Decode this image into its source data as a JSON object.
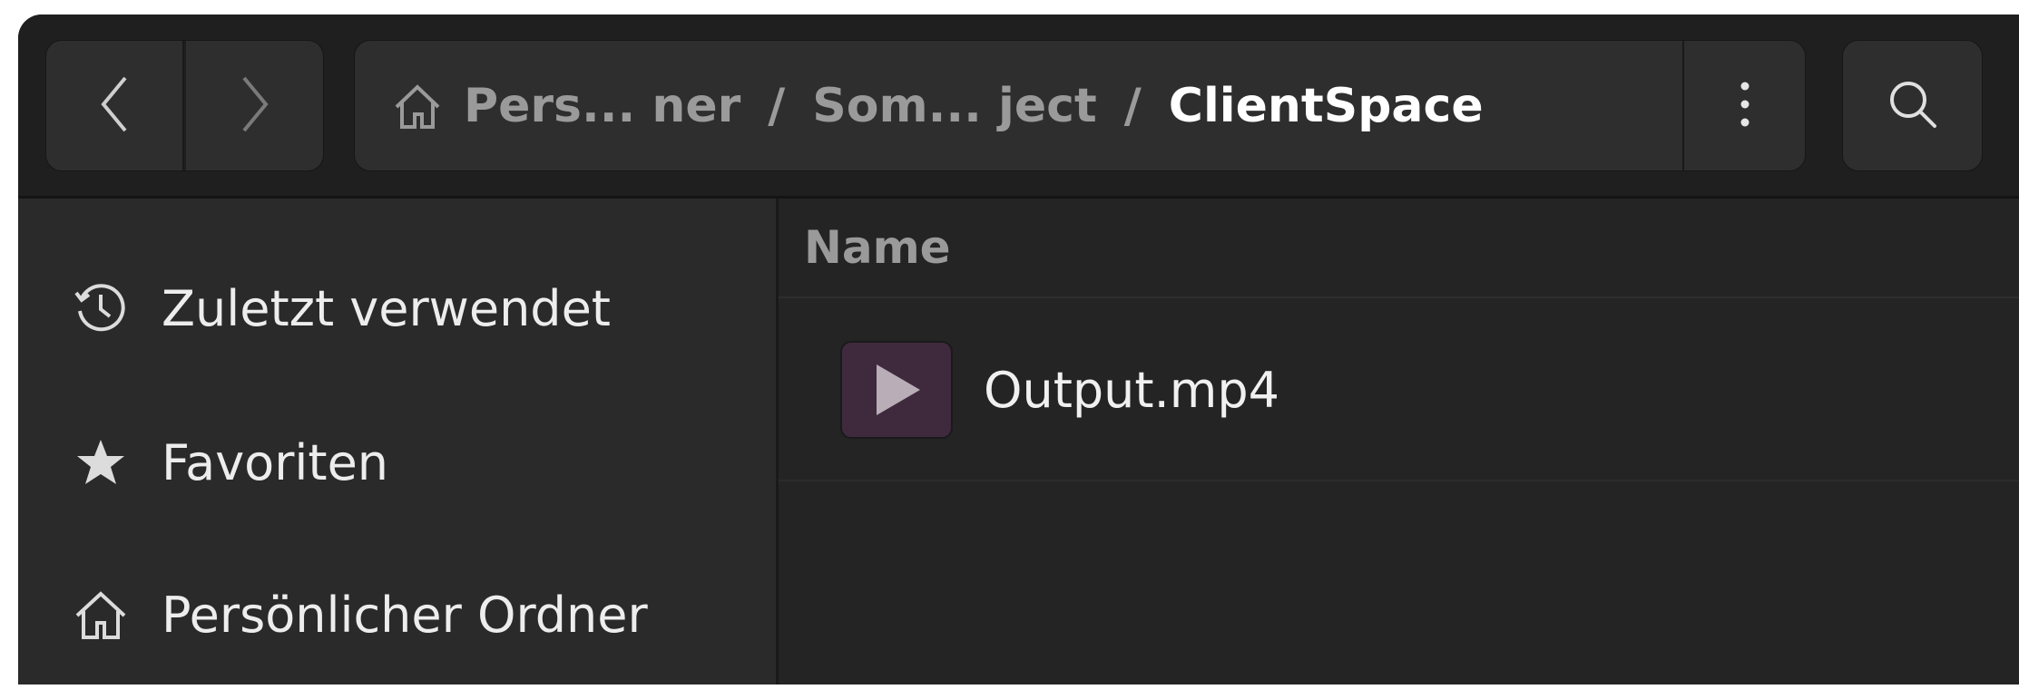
{
  "header": {
    "nav": {
      "back_icon": "chevron-left-icon",
      "forward_icon": "chevron-right-icon"
    },
    "path": {
      "home_icon": "home-icon",
      "crumbs": [
        "Pers... ner",
        "Som... ject"
      ],
      "separator": "/",
      "current": "ClientSpace"
    },
    "menu_icon": "vertical-dots-icon",
    "search_icon": "search-icon"
  },
  "sidebar": {
    "items": [
      {
        "label": "Zuletzt verwendet",
        "icon": "clock-icon"
      },
      {
        "label": "Favoriten",
        "icon": "star-icon"
      },
      {
        "label": "Persönlicher Ordner",
        "icon": "home-icon"
      }
    ]
  },
  "content": {
    "column_header": "Name",
    "files": [
      {
        "name": "Output.mp4",
        "icon": "video-file-icon"
      }
    ]
  },
  "colors": {
    "window_bg": "#242424",
    "headerbar_bg": "#1f1f1f",
    "sidebar_bg": "#2a2a2a",
    "button_bg": "#2e2e2e",
    "video_thumb_bg": "#3f2a3d"
  }
}
